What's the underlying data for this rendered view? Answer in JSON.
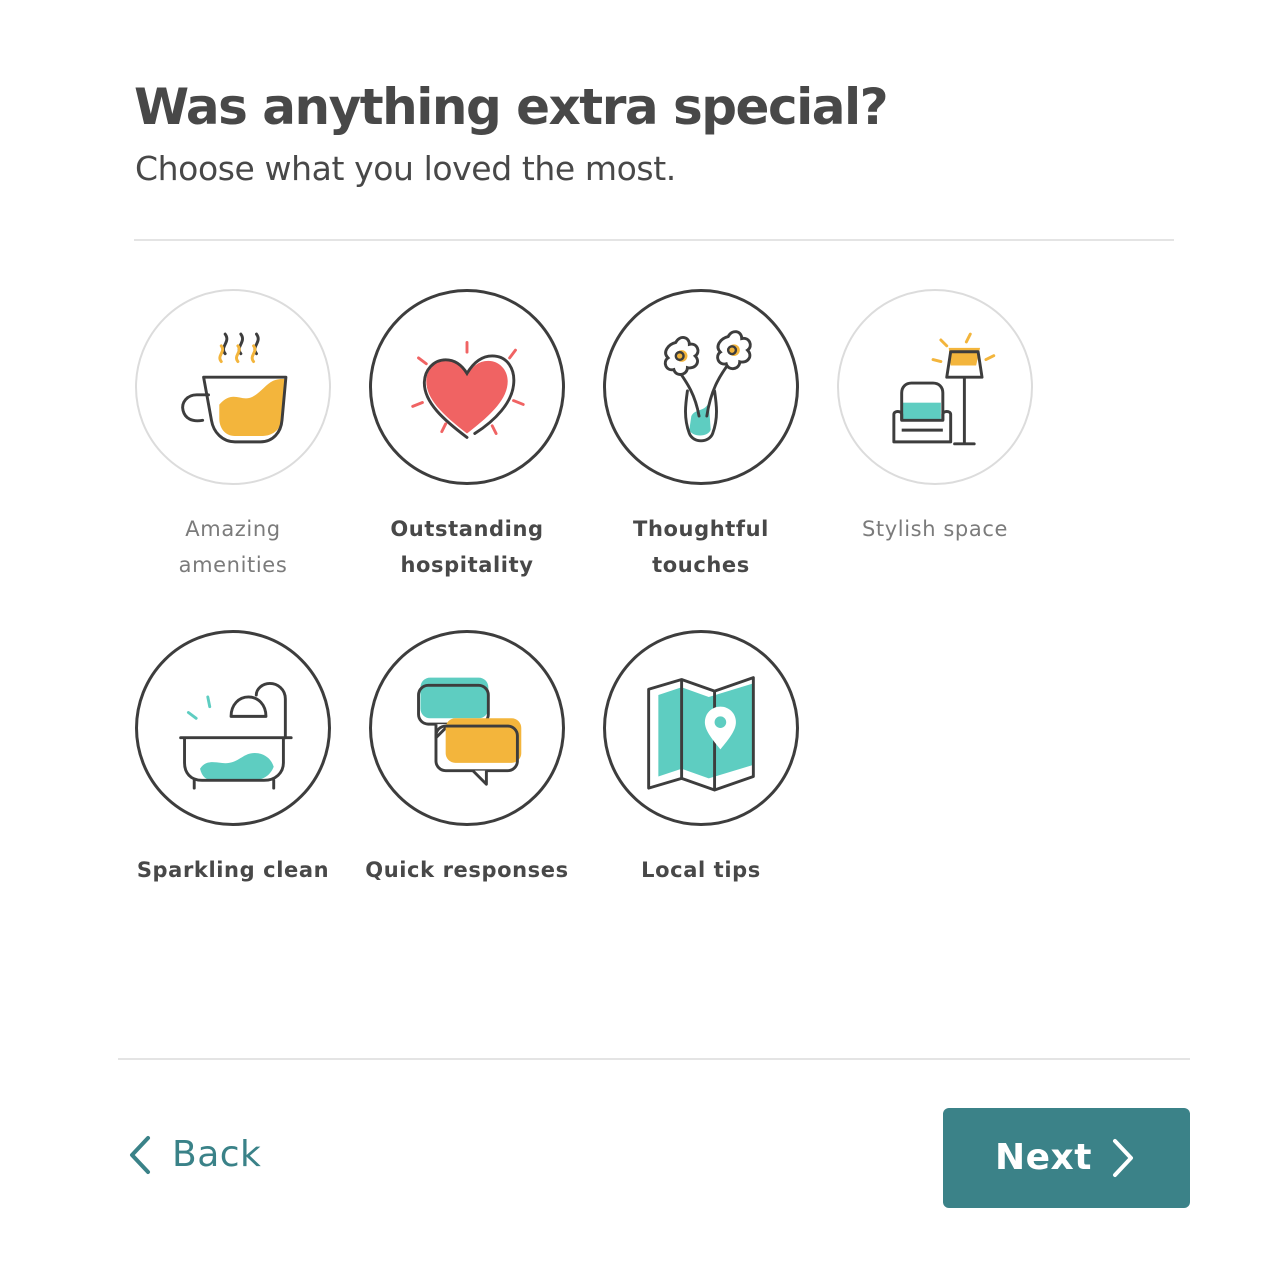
{
  "header": {
    "title": "Was anything extra special?",
    "subtitle": "Choose what you loved the most."
  },
  "options": [
    {
      "label_lines": [
        "Amazing",
        "amenities"
      ],
      "icon": "coffee-cup-icon",
      "selected": false
    },
    {
      "label_lines": [
        "Outstanding",
        "hospitality"
      ],
      "icon": "heart-icon",
      "selected": true
    },
    {
      "label_lines": [
        "Thoughtful",
        "touches"
      ],
      "icon": "flower-vase-icon",
      "selected": true
    },
    {
      "label_lines": [
        "Stylish space"
      ],
      "icon": "armchair-lamp-icon",
      "selected": false
    },
    {
      "label_lines": [
        "Sparkling clean"
      ],
      "icon": "bathtub-icon",
      "selected": true
    },
    {
      "label_lines": [
        "Quick responses"
      ],
      "icon": "chat-bubbles-icon",
      "selected": true
    },
    {
      "label_lines": [
        "Local tips"
      ],
      "icon": "map-pin-icon",
      "selected": true
    }
  ],
  "footer": {
    "back_label": "Back",
    "back_icon": "chevron-left-icon",
    "next_label": "Next",
    "next_icon": "chevron-right-icon"
  },
  "colors": {
    "accent_teal": "#3b8288",
    "icon_yellow": "#f3b53c",
    "icon_mint": "#5ecdc1",
    "icon_red": "#f06363",
    "outline_dark": "#3d3d3d"
  }
}
